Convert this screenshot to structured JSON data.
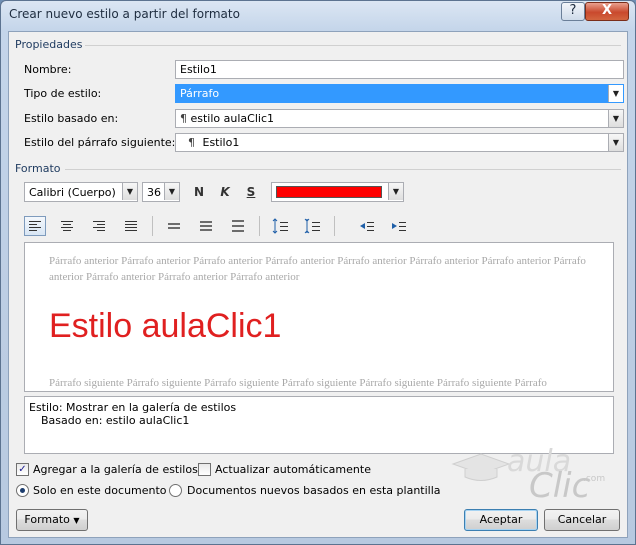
{
  "window": {
    "title": "Crear nuevo estilo a partir del formato",
    "help_glyph": "?",
    "close_glyph": "X"
  },
  "propiedades": {
    "section_label": "Propiedades",
    "nombre_label": "Nombre:",
    "nombre_value": "Estilo1",
    "tipo_label": "Tipo de estilo:",
    "tipo_value": "Párrafo",
    "basado_label": "Estilo basado en:",
    "basado_value": "estilo aulaClic1",
    "siguiente_label": "Estilo del párrafo siguiente:",
    "siguiente_value": "Estilo1",
    "para_mark": "¶"
  },
  "formato": {
    "section_label": "Formato",
    "font": "Calibri (Cuerpo)",
    "size": "36",
    "bold": "N",
    "italic": "K",
    "underline": "S",
    "font_color": "#ff0000"
  },
  "preview": {
    "before_text": "Párrafo anterior Párrafo anterior Párrafo anterior Párrafo anterior Párrafo anterior Párrafo anterior Párrafo anterior Párrafo anterior Párrafo anterior Párrafo anterior Párrafo anterior",
    "sample": "Estilo aulaClic1",
    "after_text": "Párrafo siguiente Párrafo siguiente Párrafo siguiente Párrafo siguiente Párrafo siguiente Párrafo siguiente Párrafo siguiente"
  },
  "description": {
    "line1": "Estilo: Mostrar en la galería de estilos",
    "line2": "Basado en: estilo aulaClic1"
  },
  "options": {
    "add_gallery": "Agregar a la galería de estilos",
    "auto_update": "Actualizar automáticamente",
    "only_doc": "Solo en este documento",
    "new_docs": "Documentos nuevos basados en esta plantilla"
  },
  "buttons": {
    "formato": "Formato",
    "aceptar": "Aceptar",
    "cancelar": "Cancelar"
  },
  "logo": {
    "aula": "aula",
    "clic": "Clic",
    "com": ".com"
  }
}
